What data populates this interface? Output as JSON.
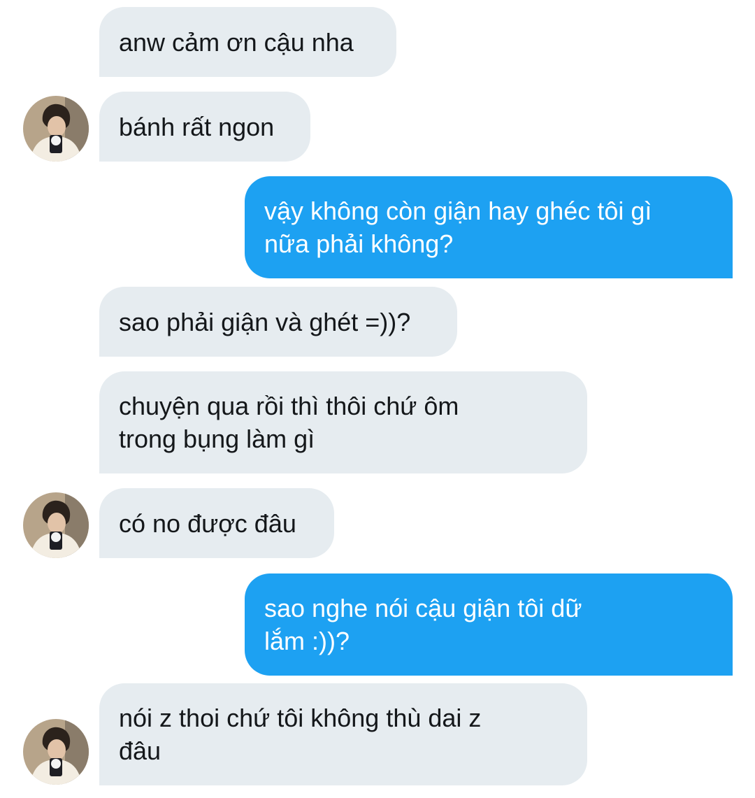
{
  "messages": [
    {
      "side": "in",
      "text": "anw cảm ơn cậu nha"
    },
    {
      "side": "in",
      "text": "bánh rất ngon"
    },
    {
      "side": "out",
      "text": "vậy không còn giận hay ghéc tôi gì\nnữa phải không?"
    },
    {
      "side": "in",
      "text": "sao phải giận và ghét =))?"
    },
    {
      "side": "in",
      "text": "chuyện qua rồi thì thôi chứ ôm\ntrong bụng làm gì"
    },
    {
      "side": "in",
      "text": "có no được đâu"
    },
    {
      "side": "out",
      "text": "sao nghe nói cậu giận tôi dữ\nlắm :))?"
    },
    {
      "side": "in",
      "text": "nói z thoi chứ tôi không thù dai z\nđâu"
    }
  ],
  "colors": {
    "incoming_bubble": "#e6ecf0",
    "outgoing_bubble": "#1da1f2"
  },
  "avatar_icon": "contact-avatar-photo"
}
